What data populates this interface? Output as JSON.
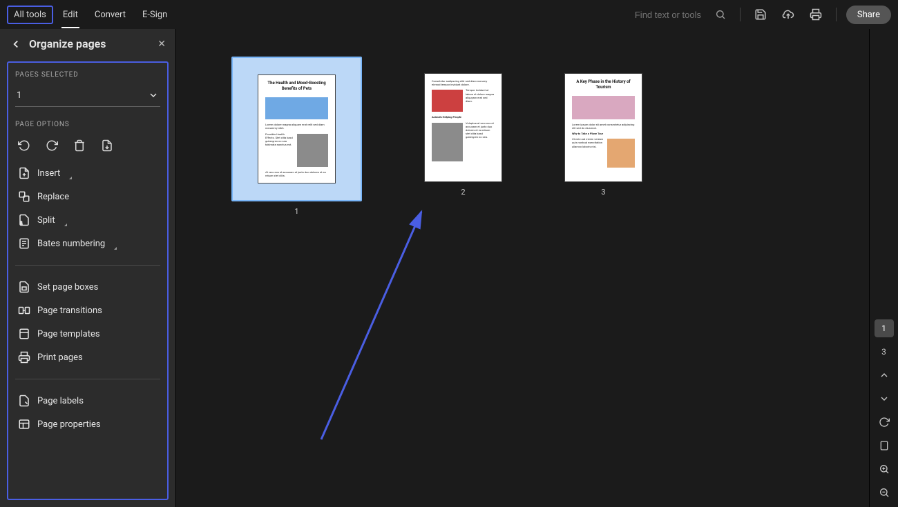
{
  "topbar": {
    "tabs": [
      "All tools",
      "Edit",
      "Convert",
      "E-Sign"
    ],
    "search_placeholder": "Find text or tools",
    "share_label": "Share"
  },
  "sidebar": {
    "title": "Organize pages",
    "pages_selected_label": "PAGES SELECTED",
    "pages_selected_value": "1",
    "page_options_label": "PAGE OPTIONS",
    "options": {
      "insert": "Insert",
      "replace": "Replace",
      "split": "Split",
      "bates": "Bates numbering",
      "set_boxes": "Set page boxes",
      "transitions": "Page transitions",
      "templates": "Page templates",
      "print": "Print pages",
      "labels": "Page labels",
      "properties": "Page properties"
    }
  },
  "pages": [
    {
      "num": "1",
      "title": "The Health and Mood-Boosting Benefits of Pets",
      "selected": true
    },
    {
      "num": "2",
      "title": "Animals Helping People",
      "selected": false
    },
    {
      "num": "3",
      "title": "A Key Phase in the History of Tourism",
      "selected": false
    }
  ],
  "rail": {
    "current_page": "1",
    "total_pages": "3"
  }
}
